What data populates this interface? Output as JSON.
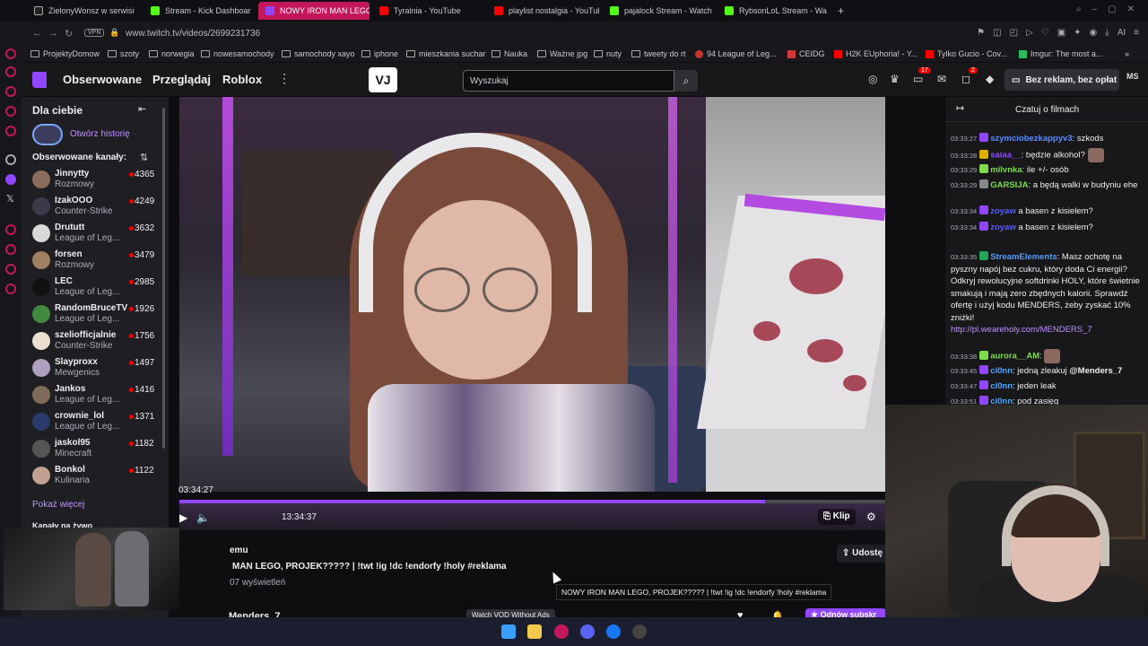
{
  "browser": {
    "tabs": [
      {
        "label": "ZielonyWonsz w serwisie X",
        "icon": "x-icon"
      },
      {
        "label": "Stream - Kick Dashboard",
        "icon": "kick-icon"
      },
      {
        "label": "NOWY IRON MAN LEGO, PROJEK",
        "icon": "twitch-icon",
        "active": true
      },
      {
        "label": "Tyralnia - YouTube",
        "icon": "youtube-icon"
      },
      {
        "label": "playlist nostalgia - YouTube",
        "icon": "youtube-icon"
      },
      {
        "label": "pajalock Stream - Watch Live",
        "icon": "kick-icon"
      },
      {
        "label": "RybsonLoL Stream - Watch",
        "icon": "kick-icon"
      }
    ],
    "new_tab": "+",
    "vpn": "VPN",
    "url": "www.twitch.tv/videos/2699231736",
    "ai_label": "AI",
    "bookmarks": [
      {
        "label": "ProjektyDomow"
      },
      {
        "label": "szoty"
      },
      {
        "label": "norwegia"
      },
      {
        "label": "nowesamochody"
      },
      {
        "label": "samochody xayo"
      },
      {
        "label": "iphone"
      },
      {
        "label": "mieszkania suchar"
      },
      {
        "label": "Nauka"
      },
      {
        "label": "Ważne jpg"
      },
      {
        "label": "nuty"
      },
      {
        "label": "tweety do rt"
      },
      {
        "label": "94 League of Leg..."
      },
      {
        "label": "CEIDG"
      },
      {
        "label": "H2K EUphoria! - Y..."
      },
      {
        "label": "Tylko Gucio - Cov..."
      },
      {
        "label": "Imgur: The most a..."
      }
    ]
  },
  "twitch_nav": {
    "links": [
      "Obserwowane",
      "Przeglądaj",
      "Roblox"
    ],
    "logo_text": "VJ",
    "search_placeholder": "Wyszukaj",
    "inbox_badge": "17",
    "notif_badge": "2",
    "no_ads_label": "Bez reklam, bez opłat",
    "user_initials": "MS"
  },
  "sidebar": {
    "title": "Dla ciebie",
    "history_link": "Otwórz historię",
    "followed_header": "Obserwowane kanały:",
    "channels": [
      {
        "name": "Jinnytty",
        "game": "Rozmowy",
        "viewers": "4365",
        "color": "#8a6d5a"
      },
      {
        "name": "IzakOOO",
        "game": "Counter-Strike",
        "viewers": "4249",
        "color": "#3a3a4a"
      },
      {
        "name": "Drututt",
        "game": "League of Leg...",
        "viewers": "3632",
        "color": "#d8d8d8"
      },
      {
        "name": "forsen",
        "game": "Rozmowy",
        "viewers": "3479",
        "color": "#a08060"
      },
      {
        "name": "LEC",
        "game": "League of Leg...",
        "viewers": "2985",
        "color": "#111111"
      },
      {
        "name": "RandomBruceTV",
        "game": "League of Leg...",
        "viewers": "1926",
        "color": "#3f8a3f"
      },
      {
        "name": "szeliofficjalnie",
        "game": "Counter-Strike",
        "viewers": "1756",
        "color": "#e8e0d0"
      },
      {
        "name": "Slayproxx",
        "game": "Mewgenics",
        "viewers": "1497",
        "color": "#b0a0c0"
      },
      {
        "name": "Jankos",
        "game": "League of Leg...",
        "viewers": "1416",
        "color": "#806a5a"
      },
      {
        "name": "crownie_lol",
        "game": "League of Leg...",
        "viewers": "1371",
        "color": "#2a3a6a"
      },
      {
        "name": "jaskol95",
        "game": "Minecraft",
        "viewers": "1182",
        "color": "#555555"
      },
      {
        "name": "Bonkol",
        "game": "Kulinaria",
        "viewers": "1122",
        "color": "#c0a090"
      }
    ],
    "show_more": "Pokaż więcej",
    "live_section": "Kanały na żywo"
  },
  "player": {
    "current_time": "03:34:27",
    "duration": "13:34:37",
    "progress_fraction": 0.83,
    "clip_label": "Klip",
    "share_label": "Udostę",
    "title_partial": "emu",
    "title": "MAN LEGO, PROJEK????? | !twt !ig !dc !endorfy !holy #reklama",
    "views": "07 wyświetleń",
    "tooltip": "NOWY IRON MAN LEGO, PROJEK????? | !twt !ig !dc !endorfy !holy #reklama",
    "streamer": "Menders_7",
    "watch_vod": "Watch VOD Without Ads",
    "subscribe_label": "Odnów subskr"
  },
  "chat": {
    "title": "Czatuj o filmach",
    "messages": [
      {
        "time": "03:33:27",
        "user": "szymciobezkappyv3",
        "color": "#5b8cff",
        "badge": "#9147ff",
        "text": ": szkods"
      },
      {
        "time": "03:33:28",
        "user": "saiaa__",
        "color": "#9147ff",
        "badge": "#e0b000",
        "text": ": będzie alkohol?"
      },
      {
        "time": "03:33:29",
        "user": "milvnka",
        "color": "#7fdc4f",
        "badge": "#7fdc4f",
        "text": ": ile +/- osób"
      },
      {
        "time": "03:33:29",
        "user": "GARSIJA",
        "color": "#7fdc4f",
        "badge": "#888888",
        "text": ": a będą walki w budyniu ehe"
      },
      {
        "time": "03:33:34",
        "user": "zoyaw",
        "color": "#5b5bff",
        "badge": "#9147ff",
        "text": " a basen z kisielem?"
      },
      {
        "time": "03:33:34",
        "user": "zoyaw",
        "color": "#5b5bff",
        "badge": "#9147ff",
        "text": " a basen z kisielem?"
      },
      {
        "time": "03:33:35",
        "user": "StreamElements",
        "color": "#4f9fff",
        "badge": "#23a55a",
        "text": ": Masz ochotę na pyszny napój bez cukru, który doda Ci energii? Odkryj rewolucyjne softdrinki HOLY, które świetnie smakują i mają zero zbędnych kalorii. Sprawdź ofertę i użyj kodu MENDERS, żeby zyskać 10% zniżki!",
        "link": "http://pl.weareholy.com/MENDERS_7"
      },
      {
        "time": "03:33:38",
        "user": "aurora__AM",
        "color": "#7fdc4f",
        "badge": "#7fdc4f",
        "text": ":"
      },
      {
        "time": "03:33:45",
        "user": "ci0nn",
        "color": "#4fa6ff",
        "badge": "#9147ff",
        "text": ": jedną zleakuj ",
        "mention": "@Menders_7"
      },
      {
        "time": "03:33:47",
        "user": "ci0nn",
        "color": "#4fa6ff",
        "badge": "#9147ff",
        "text": ": jeden leak"
      },
      {
        "time": "03:33:51",
        "user": "ci0nn",
        "color": "#4fa6ff",
        "badge": "#9147ff",
        "text": ": pod zasięg"
      }
    ]
  }
}
